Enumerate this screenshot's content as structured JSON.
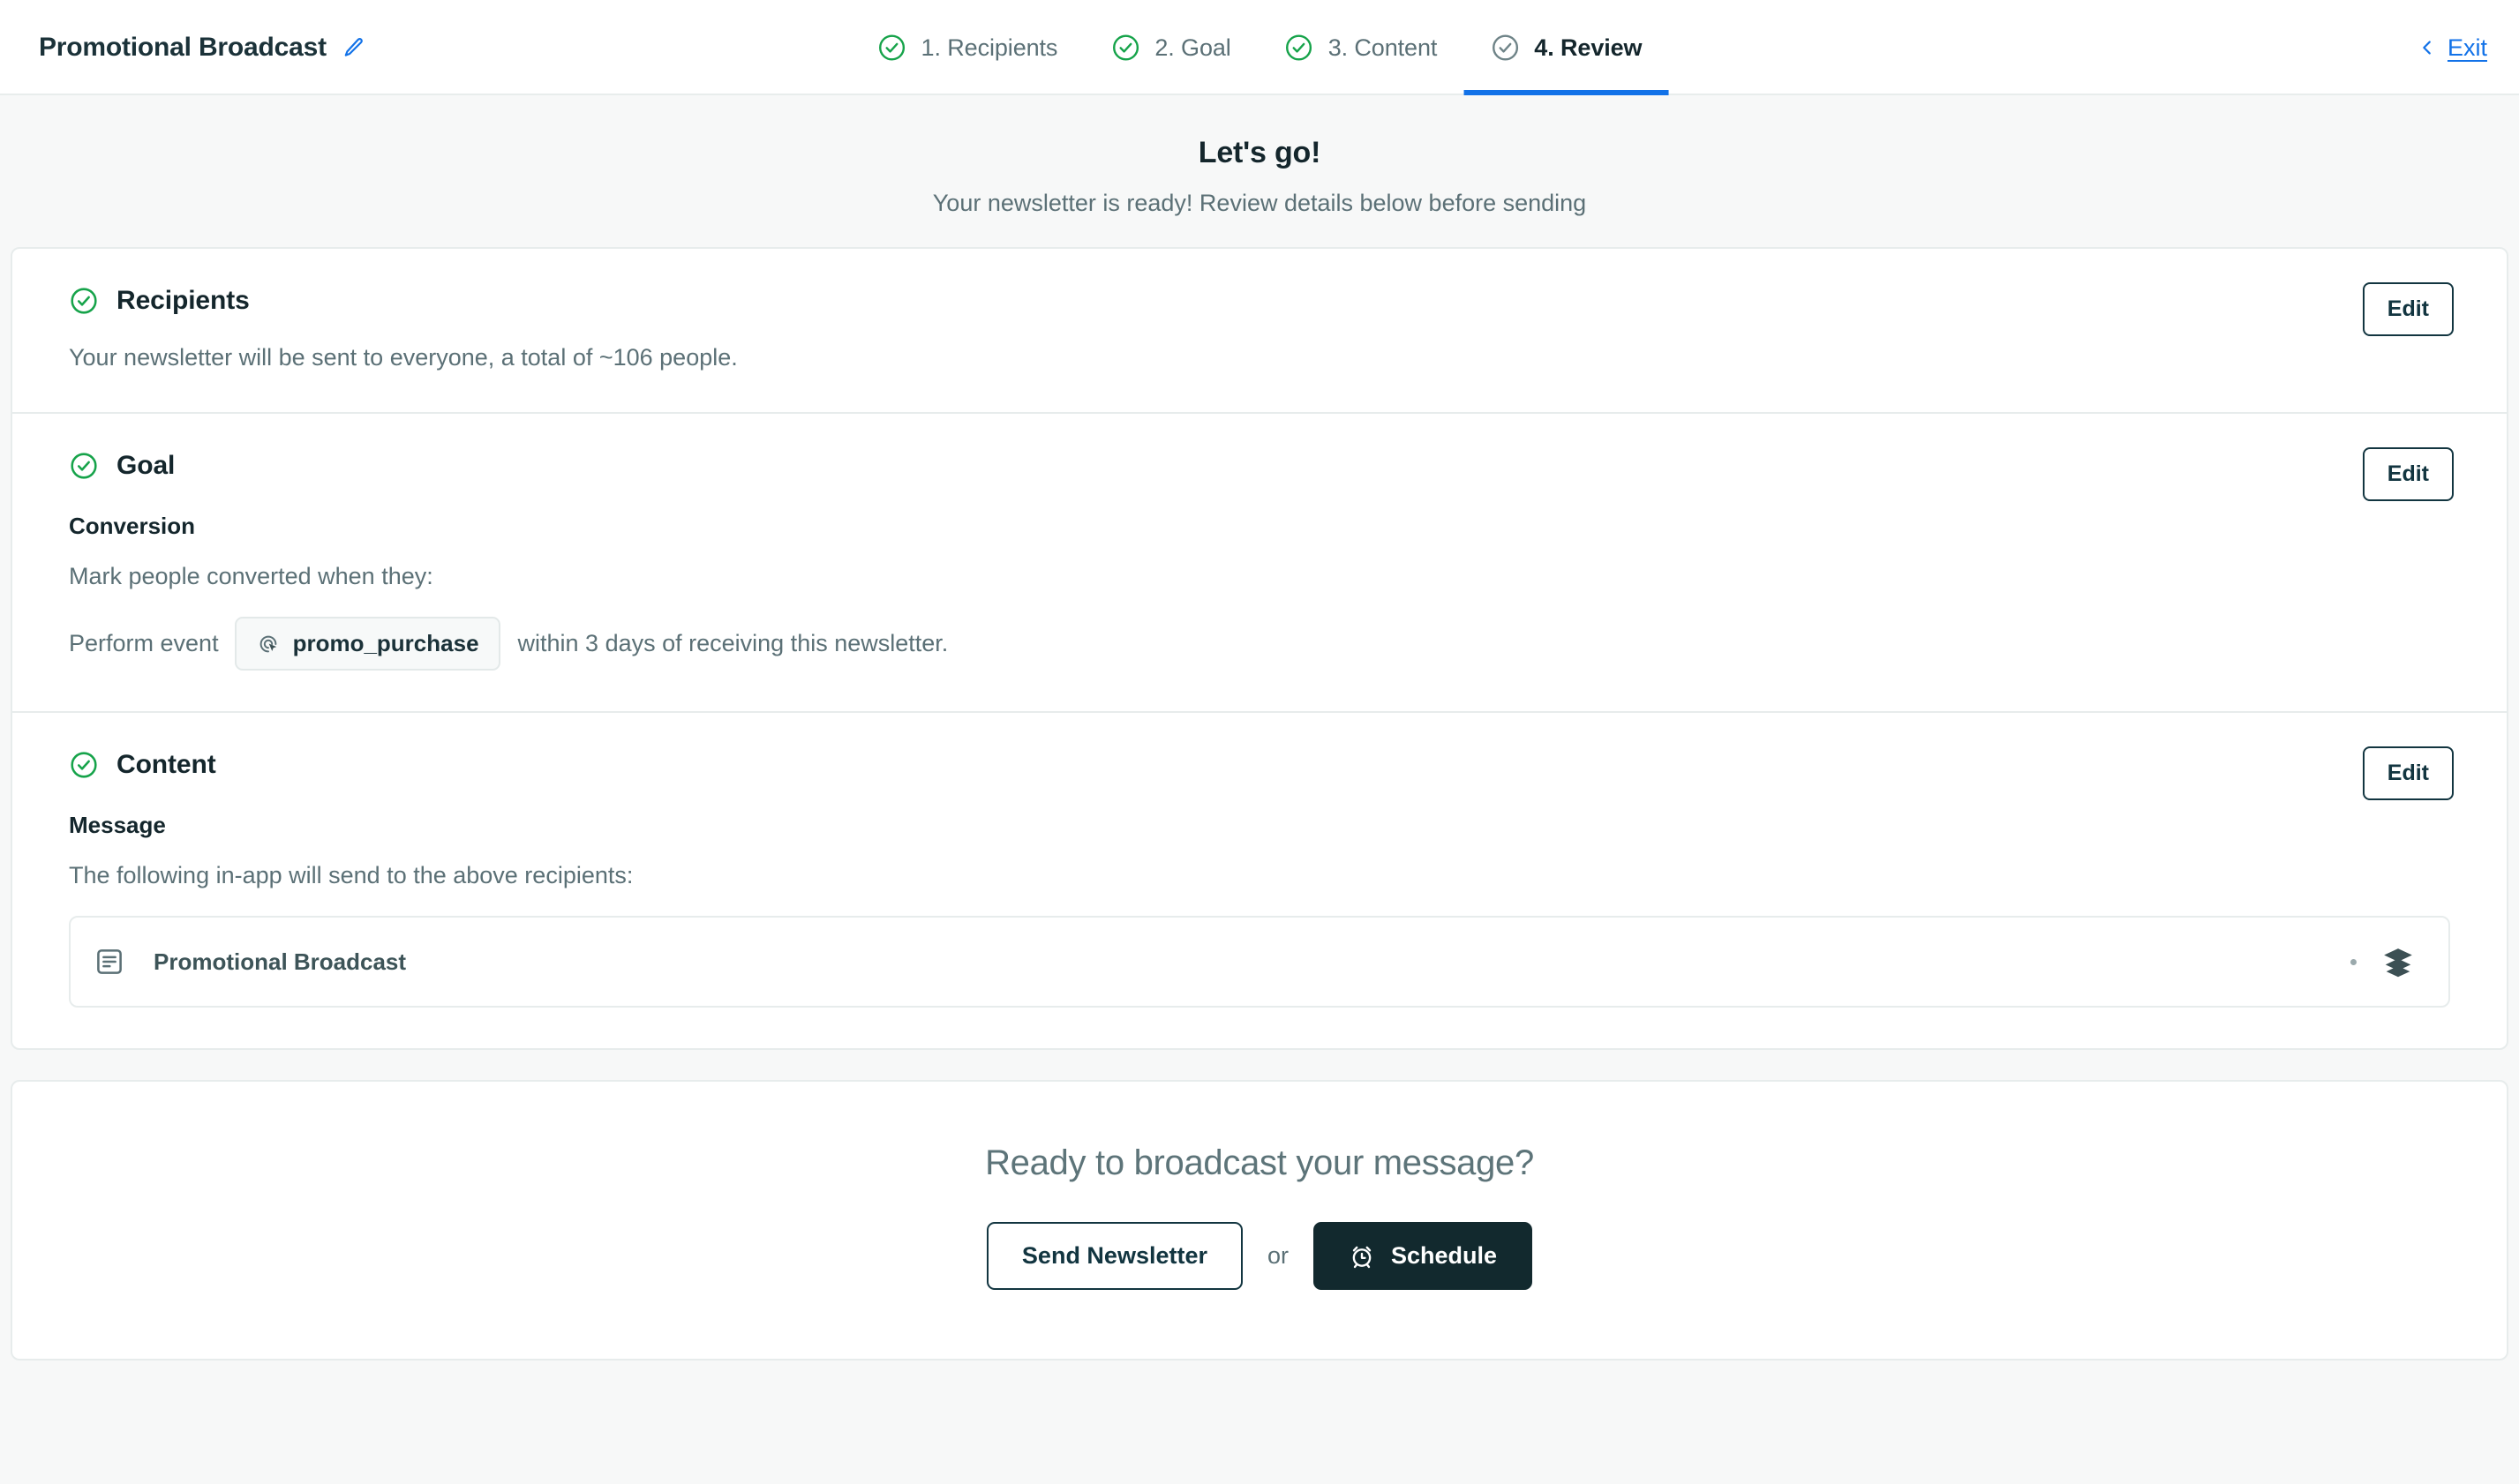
{
  "topbar": {
    "broadcast_name": "Promotional Broadcast",
    "edit_name_icon": "pencil-icon",
    "exit_label": "Exit",
    "exit_chevron_icon": "chevron-left-icon",
    "steps": [
      {
        "label": "1. Recipients",
        "state": "complete",
        "icon": "check-circle-icon"
      },
      {
        "label": "2. Goal",
        "state": "complete",
        "icon": "check-circle-icon"
      },
      {
        "label": "3. Content",
        "state": "complete",
        "icon": "check-circle-icon"
      },
      {
        "label": "4. Review",
        "state": "active",
        "icon": "check-circle-icon"
      }
    ]
  },
  "page": {
    "title": "Let's go!",
    "subtitle": "Your newsletter is ready! Review details below before sending"
  },
  "recipients": {
    "title": "Recipients",
    "check_icon": "check-circle-icon",
    "edit_label": "Edit",
    "summary": "Your newsletter will be sent to everyone, a total of ~106 people."
  },
  "goal": {
    "title": "Goal",
    "check_icon": "check-circle-icon",
    "edit_label": "Edit",
    "subheading": "Conversion",
    "hint": "Mark people converted when they:",
    "event_prefix": "Perform event",
    "event_chip_label": "promo_purchase",
    "event_chip_icon": "event-click-icon",
    "event_suffix": "within 3 days of receiving this newsletter."
  },
  "content": {
    "title": "Content",
    "check_icon": "check-circle-icon",
    "edit_label": "Edit",
    "subheading": "Message",
    "hint": "The following in-app will send to the above recipients:",
    "message": {
      "doc_icon": "document-lines-icon",
      "name": "Promotional Broadcast",
      "layers_icon": "layers-stack-icon"
    }
  },
  "cta": {
    "title": "Ready to broadcast your message?",
    "send_label": "Send Newsletter",
    "or_label": "or",
    "schedule_label": "Schedule",
    "schedule_icon": "alarm-clock-icon"
  },
  "colors": {
    "accent_blue": "#1272e8",
    "success_green": "#16a34a",
    "dark_navy": "#12292e",
    "muted_text": "#5b7076",
    "page_bg": "#f7f8f8",
    "border": "#e7ecec"
  }
}
